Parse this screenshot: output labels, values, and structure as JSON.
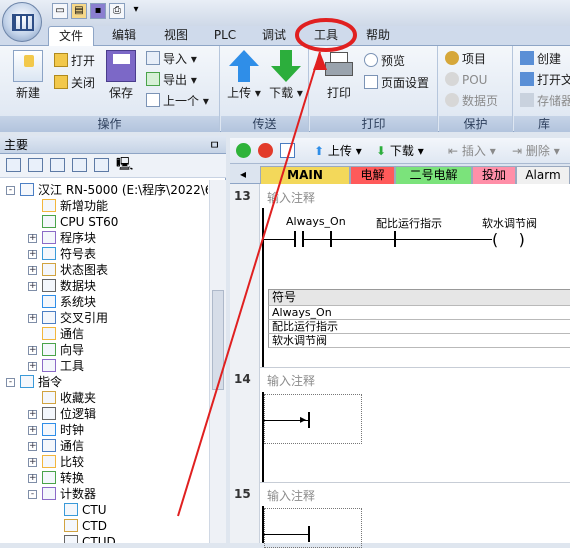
{
  "quick_access": {
    "icons": [
      "new-file-icon",
      "open-folder-icon",
      "save-icon",
      "print-icon"
    ],
    "menu_arrow": "▾"
  },
  "tabs": [
    {
      "label": "文件",
      "active": true
    },
    {
      "label": "编辑"
    },
    {
      "label": "视图"
    },
    {
      "label": "PLC"
    },
    {
      "label": "调试"
    },
    {
      "label": "工具"
    },
    {
      "label": "帮助"
    }
  ],
  "ribbon": {
    "groups": {
      "operations": "操作",
      "transfer": "传送",
      "print": "打印",
      "protect": "保护",
      "library": "库"
    },
    "new": "新建",
    "open": "打开",
    "close": "关闭",
    "save": "保存",
    "import": "导入",
    "export": "导出",
    "previous": "上一个",
    "upload": "上传",
    "download": "下载",
    "print": "打印",
    "preview": "预览",
    "page_setup": "页面设置",
    "project": "项目",
    "pou": "POU",
    "data_page": "数据页",
    "create": "创建",
    "open_file": "打开文",
    "storage": "存储器"
  },
  "left_panel": {
    "title": "主要",
    "pin": "ㅁ",
    "tree": [
      {
        "label": "汉江 RN-5000 (E:\\程序\\2022\\6月'",
        "level": 0,
        "toggle": "-"
      },
      {
        "label": "新增功能",
        "level": 1,
        "toggle": ""
      },
      {
        "label": "CPU ST60",
        "level": 1,
        "toggle": ""
      },
      {
        "label": "程序块",
        "level": 1,
        "toggle": "+"
      },
      {
        "label": "符号表",
        "level": 1,
        "toggle": "+"
      },
      {
        "label": "状态图表",
        "level": 1,
        "toggle": "+"
      },
      {
        "label": "数据块",
        "level": 1,
        "toggle": "+"
      },
      {
        "label": "系统块",
        "level": 1,
        "toggle": ""
      },
      {
        "label": "交叉引用",
        "level": 1,
        "toggle": "+"
      },
      {
        "label": "通信",
        "level": 1,
        "toggle": ""
      },
      {
        "label": "向导",
        "level": 1,
        "toggle": "+"
      },
      {
        "label": "工具",
        "level": 1,
        "toggle": "+"
      },
      {
        "label": "指令",
        "level": 0,
        "toggle": "-"
      },
      {
        "label": "收藏夹",
        "level": 1,
        "toggle": ""
      },
      {
        "label": "位逻辑",
        "level": 1,
        "toggle": "+"
      },
      {
        "label": "时钟",
        "level": 1,
        "toggle": "+"
      },
      {
        "label": "通信",
        "level": 1,
        "toggle": "+"
      },
      {
        "label": "比较",
        "level": 1,
        "toggle": "+"
      },
      {
        "label": "转换",
        "level": 1,
        "toggle": "+"
      },
      {
        "label": "计数器",
        "level": 1,
        "toggle": "-"
      },
      {
        "label": "CTU",
        "level": 2,
        "toggle": ""
      },
      {
        "label": "CTD",
        "level": 2,
        "toggle": ""
      },
      {
        "label": "CTUD",
        "level": 2,
        "toggle": ""
      }
    ]
  },
  "editor_toolbar": {
    "upload": "上传",
    "download": "下载",
    "insert": "插入",
    "delete": "删除"
  },
  "program_tabs": [
    {
      "label": "MAIN",
      "color": "#f3d85a"
    },
    {
      "label": "电解",
      "color": "#ff5a5a"
    },
    {
      "label": "二号电解",
      "color": "#7be37b"
    },
    {
      "label": "投加",
      "color": "#ff8fa8"
    },
    {
      "label": "Alarm",
      "color": "#f0f0f0"
    }
  ],
  "networks": [
    {
      "number": "13",
      "comment": "输入注释",
      "contact1": "Always_On",
      "contact2": "配比运行指示",
      "coil": "软水调节阀",
      "symbol_header": "符号",
      "symbols": [
        "Always_On",
        "配比运行指示",
        "软水调节阀"
      ]
    },
    {
      "number": "14",
      "comment": "输入注释"
    },
    {
      "number": "15",
      "comment": "输入注释"
    }
  ],
  "colors": {
    "annotation_red": "#e02020",
    "ribbon_blue": "#dce5f1"
  }
}
